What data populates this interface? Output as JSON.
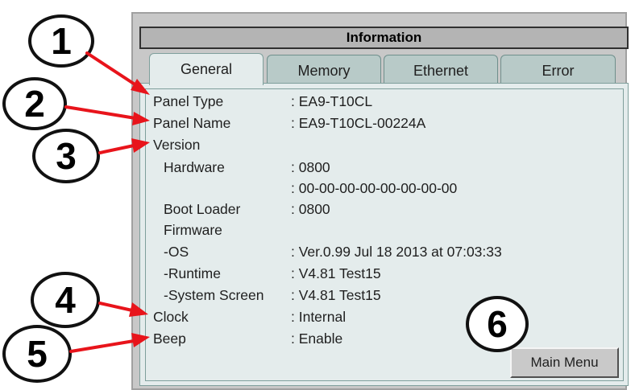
{
  "window": {
    "title": "Information"
  },
  "tabs": [
    {
      "label": "General",
      "active": true
    },
    {
      "label": "Memory",
      "active": false
    },
    {
      "label": "Ethernet",
      "active": false
    },
    {
      "label": "Error",
      "active": false
    }
  ],
  "info": {
    "panel_type_label": "Panel Type",
    "panel_type_value": ": EA9-T10CL",
    "panel_name_label": "Panel Name",
    "panel_name_value": ": EA9-T10CL-00224A",
    "version_label": "Version",
    "hardware_label": "Hardware",
    "hardware_value": ": 0800",
    "hardware_value2": ": 00-00-00-00-00-00-00-00",
    "boot_loader_label": "Boot Loader",
    "boot_loader_value": ": 0800",
    "firmware_label": "Firmware",
    "os_label": "-OS",
    "os_value": ": Ver.0.99 Jul 18 2013 at 07:03:33",
    "runtime_label": "-Runtime",
    "runtime_value": ": V4.81 Test15",
    "system_screen_label": "-System Screen",
    "system_screen_value": ": V4.81 Test15",
    "clock_label": "Clock",
    "clock_value": ": Internal",
    "beep_label": "Beep",
    "beep_value": ": Enable"
  },
  "buttons": {
    "main_menu": "Main Menu"
  },
  "callouts": [
    "1",
    "2",
    "3",
    "4",
    "5",
    "6"
  ],
  "colors": {
    "arrow": "#e8141b",
    "tab_bg": "#b8cac8",
    "content_bg": "#e4ecec",
    "panel_bg": "#c8c8c8"
  }
}
